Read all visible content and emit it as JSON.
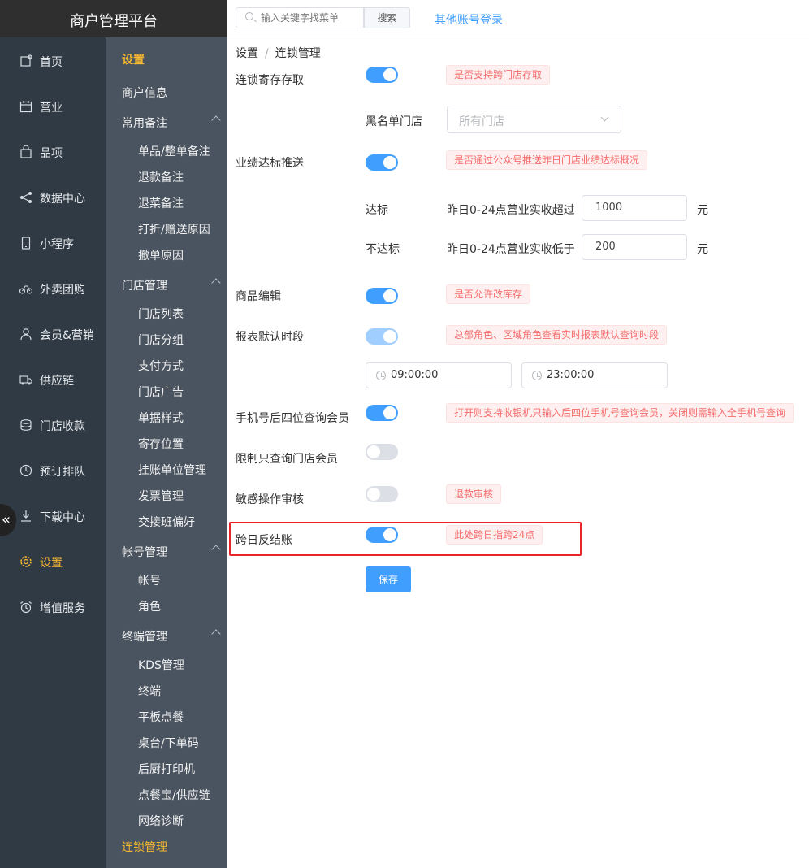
{
  "brand": {
    "title": "商户管理平台"
  },
  "topbar": {
    "search_placeholder": "输入关键字找菜单",
    "search_button": "搜索",
    "other_login": "其他账号登录"
  },
  "nav1": {
    "items": [
      {
        "label": "首页",
        "icon": "home-icon"
      },
      {
        "label": "营业",
        "icon": "calendar-icon"
      },
      {
        "label": "品项",
        "icon": "bag-icon"
      },
      {
        "label": "数据中心",
        "icon": "share-icon"
      },
      {
        "label": "小程序",
        "icon": "phone-icon"
      },
      {
        "label": "外卖团购",
        "icon": "bike-icon"
      },
      {
        "label": "会员&营销",
        "icon": "user-icon"
      },
      {
        "label": "供应链",
        "icon": "truck-icon"
      },
      {
        "label": "门店收款",
        "icon": "coins-icon"
      },
      {
        "label": "预订排队",
        "icon": "clock-icon"
      },
      {
        "label": "下载中心",
        "icon": "download-icon"
      },
      {
        "label": "设置",
        "icon": "gear-icon"
      },
      {
        "label": "增值服务",
        "icon": "alarm-icon"
      }
    ],
    "active_color": "#f7b831"
  },
  "nav2": {
    "title": "设置",
    "merchant_info": "商户信息",
    "groups": {
      "notes": {
        "label": "常用备注",
        "items": [
          "单品/整单备注",
          "退款备注",
          "退菜备注",
          "打折/赠送原因",
          "撤单原因"
        ]
      },
      "store": {
        "label": "门店管理",
        "items": [
          "门店列表",
          "门店分组",
          "支付方式",
          "门店广告",
          "单据样式",
          "寄存位置",
          "挂账单位管理",
          "发票管理",
          "交接班偏好"
        ]
      },
      "account": {
        "label": "帐号管理",
        "items": [
          "帐号",
          "角色"
        ]
      },
      "terminal": {
        "label": "终端管理",
        "items": [
          "KDS管理",
          "终端",
          "平板点餐",
          "桌台/下单码",
          "后厨打印机",
          "点餐宝/供应链",
          "网络诊断"
        ]
      }
    },
    "chain_mgmt": "连锁管理"
  },
  "breadcrumb": {
    "root": "设置",
    "sep": "/",
    "current": "连锁管理"
  },
  "settings": {
    "deposit": {
      "label": "连锁寄存存取",
      "tag": "是否支持跨门店存取"
    },
    "blacklist": {
      "label": "黑名单门店",
      "placeholder": "所有门店"
    },
    "perf_push": {
      "label": "业绩达标推送",
      "tag": "是否通过公众号推送昨日门店业绩达标概况"
    },
    "reach": {
      "label": "达标",
      "desc": "昨日0-24点营业实收超过",
      "value": "1000",
      "unit": "元"
    },
    "not_reach": {
      "label": "不达标",
      "desc": "昨日0-24点营业实收低于",
      "value": "200",
      "unit": "元"
    },
    "goods_edit": {
      "label": "商品编辑",
      "tag": "是否允许改库存"
    },
    "report_period": {
      "label": "报表默认时段",
      "tag": "总部角色、区域角色查看实时报表默认查询时段",
      "start": "09:00:00",
      "end": "23:00:00"
    },
    "phone_last4": {
      "label": "手机号后四位查询会员",
      "tag": "打开则支持收银机只输入后四位手机号查询会员，关闭则需输入全手机号查询"
    },
    "store_member_only": {
      "label": "限制只查询门店会员"
    },
    "sensitive_audit": {
      "label": "敏感操作审核",
      "tag": "退款审核"
    },
    "cross_day": {
      "label": "跨日反结账",
      "tag": "此处跨日指跨24点"
    }
  },
  "save_button": "保存"
}
